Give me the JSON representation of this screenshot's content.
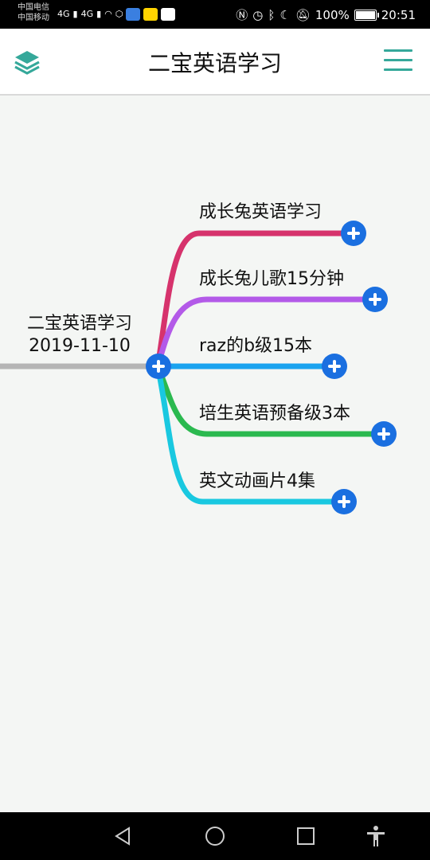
{
  "status_bar": {
    "carrier_1": "中国电信",
    "carrier_2": "中国移动",
    "network_1": "4G",
    "network_2": "4G",
    "battery_percent": "100%",
    "time": "20:51",
    "battery_level": 1.0
  },
  "header": {
    "title": "二宝英语学习",
    "left_icon": "layers-icon",
    "right_icon": "menu-icon",
    "accent_color": "#35a89a"
  },
  "mindmap": {
    "root": {
      "title": "二宝英语学习",
      "date": "2019-11-10"
    },
    "branches": [
      {
        "label": "成长兔英语学习",
        "color": "#d6336c"
      },
      {
        "label": "成长兔儿歌15分钟",
        "color": "#b35ae8"
      },
      {
        "label": "raz的b级15本",
        "color": "#1aa3ef"
      },
      {
        "label": "培生英语预备级3本",
        "color": "#2bb94f"
      },
      {
        "label": "英文动画片4集",
        "color": "#19c8e0"
      }
    ],
    "add_button_color": "#1a6fe0"
  },
  "nav_bar": {
    "back_icon": "back-triangle-icon",
    "home_icon": "home-circle-icon",
    "recents_icon": "recents-square-icon",
    "accessibility_icon": "accessibility-icon"
  }
}
